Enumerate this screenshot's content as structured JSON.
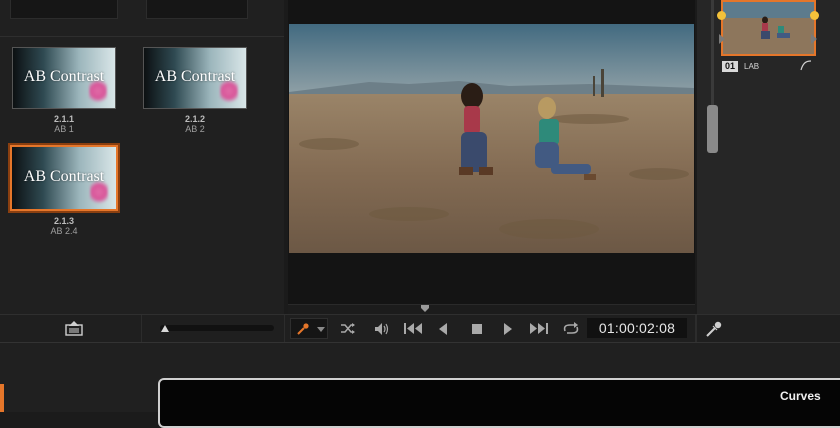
{
  "gallery": {
    "stills": [
      {
        "thumb_title": "AB Contrast",
        "number": "2.1.1",
        "label": "AB 1",
        "selected": false
      },
      {
        "thumb_title": "AB Contrast",
        "number": "2.1.2",
        "label": "AB 2",
        "selected": false
      },
      {
        "thumb_title": "AB Contrast",
        "number": "2.1.3",
        "label": "AB 2.4",
        "selected": true
      }
    ],
    "slider_value": 0.0
  },
  "viewer": {
    "timecode": "01:00:02:08"
  },
  "node_editor": {
    "node": {
      "id": "01",
      "name": "LAB"
    }
  },
  "curves": {
    "title": "Curves"
  },
  "colors": {
    "selection_accent": "#e5762a",
    "node_handle": "#f3c13a"
  },
  "icons": {
    "gallery_grab": "grab-still-icon",
    "eyedropper": "eyedropper-icon",
    "shuffle": "shuffle-icon",
    "speaker": "speaker-icon",
    "jump_start": "jump-to-start-icon",
    "play_reverse": "play-reverse-icon",
    "stop": "stop-icon",
    "play": "play-icon",
    "jump_end": "jump-to-end-icon",
    "loop": "loop-icon",
    "node_picker": "node-picker-icon"
  }
}
